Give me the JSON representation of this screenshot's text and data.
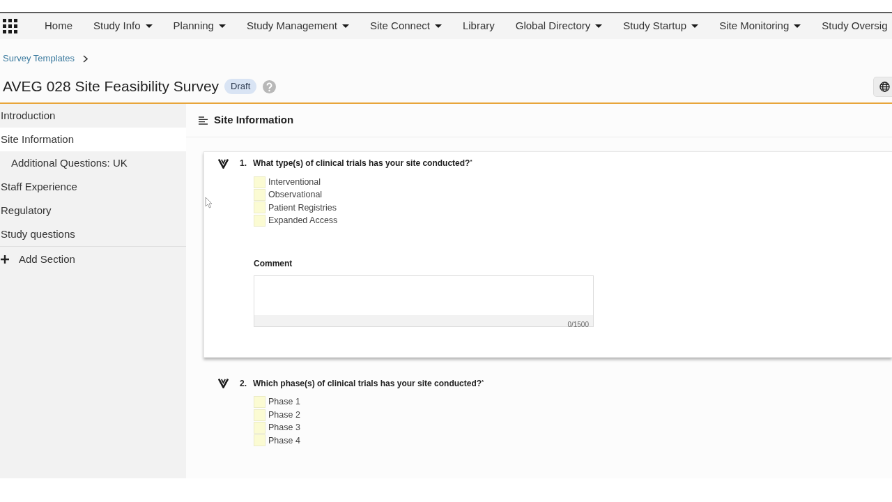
{
  "nav": {
    "items": [
      {
        "label": "Home",
        "dropdown": false
      },
      {
        "label": "Study Info",
        "dropdown": true
      },
      {
        "label": "Planning",
        "dropdown": true
      },
      {
        "label": "Study Management",
        "dropdown": true
      },
      {
        "label": "Site Connect",
        "dropdown": true
      },
      {
        "label": "Library",
        "dropdown": false
      },
      {
        "label": "Global Directory",
        "dropdown": true
      },
      {
        "label": "Study Startup",
        "dropdown": true
      },
      {
        "label": "Site Monitoring",
        "dropdown": true
      },
      {
        "label": "Study Oversig",
        "dropdown": false
      }
    ]
  },
  "breadcrumb": [
    {
      "label": "Survey Templates"
    }
  ],
  "header": {
    "title": "AVEG 028 Site Feasibility Survey",
    "status_badge": "Draft"
  },
  "sidebar": {
    "items": [
      {
        "label": "Introduction",
        "selected": false
      },
      {
        "label": "Site Information",
        "selected": true,
        "children": [
          {
            "label": "Additional Questions: UK",
            "selected": false
          }
        ]
      },
      {
        "label": "Staff Experience",
        "selected": false
      },
      {
        "label": "Regulatory",
        "selected": false
      },
      {
        "label": "Study questions",
        "selected": false
      }
    ],
    "add_section": "Add Section"
  },
  "section": {
    "title": "Site Information",
    "questions": [
      {
        "number": "1.",
        "text": "What type(s) of clinical trials has your site conducted?$^{*}$",
        "selected": true,
        "options": [
          {
            "label": "Interventional",
            "checked": false
          },
          {
            "label": "Observational",
            "checked": false
          },
          {
            "label": "Patient Registries",
            "checked": false
          },
          {
            "label": "Expanded Access",
            "checked": false
          }
        ],
        "comment": {
          "label": "Comment",
          "counter": "0/1500"
        }
      },
      {
        "number": "2.",
        "text": "Which phase(s) of clinical trials has your site conducted?$^{*}$",
        "selected": false,
        "options": [
          {
            "label": "Phase 1",
            "checked": false
          },
          {
            "label": "Phase 2",
            "checked": false
          },
          {
            "label": "Phase 3",
            "checked": false
          },
          {
            "label": "Phase 4",
            "checked": false
          }
        ]
      }
    ]
  }
}
